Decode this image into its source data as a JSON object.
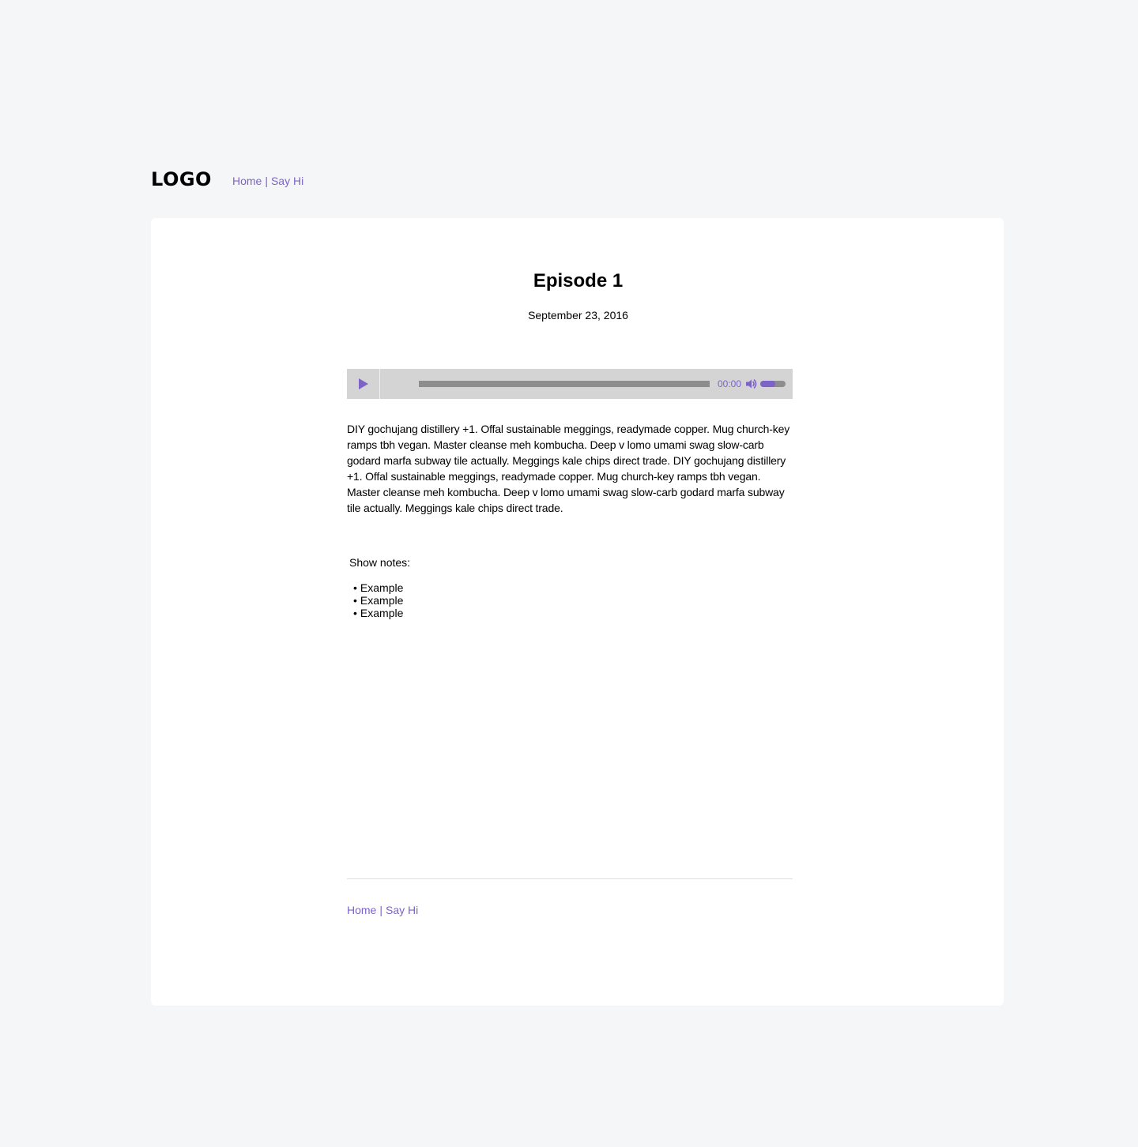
{
  "header": {
    "logo": "LOGO",
    "nav": [
      {
        "label": "Home"
      },
      {
        "label": "Say Hi"
      }
    ],
    "separator": "|"
  },
  "episode": {
    "title": "Episode 1",
    "date": "September 23, 2016",
    "description": "DIY gochujang distillery +1. Offal sustainable meggings, readymade copper. Mug church-key ramps tbh vegan. Master cleanse meh kombucha. Deep v lomo umami swag slow-carb godard marfa subway tile actually. Meggings kale chips direct trade. DIY gochujang distillery +1. Offal sustainable meggings, readymade copper. Mug church-key ramps tbh vegan. Master cleanse meh kombucha. Deep v lomo umami swag slow-carb godard marfa subway tile actually. Meggings kale chips direct trade."
  },
  "player": {
    "time": "00:00",
    "progress_fraction": 0,
    "volume_fraction": 0.6,
    "play_icon": "play-icon",
    "volume_icon": "speaker-volume-icon",
    "accent_color": "#7d63c7",
    "track_color": "#8d8d8d",
    "background_color": "#d4d4d4"
  },
  "notes": {
    "label": "Show notes:",
    "items": [
      "Example",
      "Example",
      "Example"
    ]
  },
  "footer": {
    "nav": [
      {
        "label": "Home"
      },
      {
        "label": "Say Hi"
      }
    ],
    "separator": "|"
  },
  "colors": {
    "page_background": "#f5f6f8",
    "card_background": "#ffffff",
    "link": "#7d63c7"
  }
}
